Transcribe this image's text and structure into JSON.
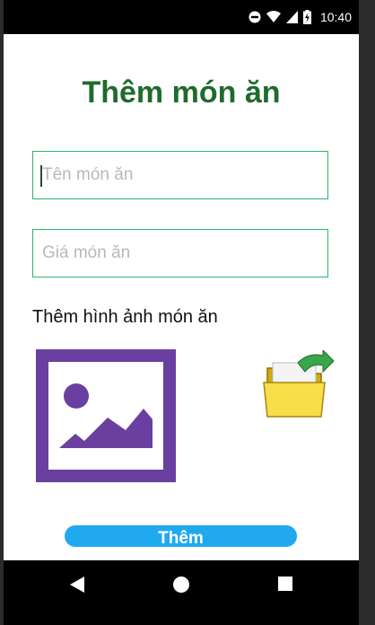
{
  "status_bar": {
    "time": "10:40",
    "icons": [
      "do-not-disturb-icon",
      "wifi-icon",
      "signal-icon",
      "battery-charging-icon"
    ]
  },
  "screen": {
    "title": "Thêm món ăn",
    "name_input": {
      "value": "",
      "placeholder": "Tên món ăn"
    },
    "price_input": {
      "value": "",
      "placeholder": "Giá món ăn"
    },
    "image_section_label": "Thêm hình ảnh món ăn",
    "image_placeholder_icon": "image-placeholder-icon",
    "browse_icon": "folder-open-icon",
    "add_button_label": "Thêm"
  },
  "nav_bar": {
    "icons": [
      "back-icon",
      "home-icon",
      "recents-icon"
    ]
  },
  "colors": {
    "title": "#1f6b2c",
    "input_border": "#2ab56b",
    "placeholder": "#b9b9b9",
    "button": "#21a9ef",
    "image_frame": "#6b3fa0"
  }
}
